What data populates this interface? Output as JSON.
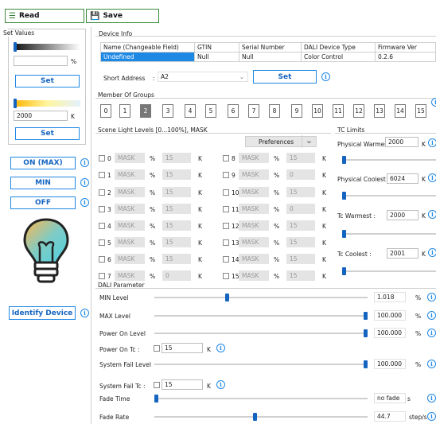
{
  "toolbar": {
    "read_label": "Read",
    "save_label": "Save"
  },
  "set_values": {
    "title": "Set Values",
    "pct_unit": "%",
    "set_label": "Set",
    "cct_value": "2000",
    "cct_unit": "K",
    "set2_label": "Set",
    "on_label": "ON (MAX)",
    "min_label": "MIN",
    "off_label": "OFF",
    "identify_label": "Identify Device"
  },
  "device_info": {
    "title": "Device Info",
    "headers": [
      "Name (Changeable Field)",
      "GTIN",
      "Serial Number",
      "DALI Device Type",
      "Firmware Ver"
    ],
    "row": [
      "Undefined",
      "Null",
      "Null",
      "Color Control",
      "0.2.6"
    ],
    "short_address_label": "Short Address",
    "short_address_colon": ":",
    "short_address_value": "A2",
    "set_label": "Set"
  },
  "groups": {
    "title": "Member Of Groups",
    "items": [
      "0",
      "1",
      "2",
      "3",
      "4",
      "5",
      "6",
      "7",
      "8",
      "9",
      "10",
      "11",
      "12",
      "13",
      "14",
      "15"
    ],
    "selected": 2
  },
  "scenes": {
    "title": "Scene Light Levels [0...100%], MASK",
    "preferences_label": "Preferences",
    "left": [
      {
        "n": "0",
        "mask": "MASK",
        "pct": "%",
        "val": "15",
        "k": "K"
      },
      {
        "n": "1",
        "mask": "MASK",
        "pct": "%",
        "val": "15",
        "k": "K"
      },
      {
        "n": "2",
        "mask": "MASK",
        "pct": "%",
        "val": "15",
        "k": "K"
      },
      {
        "n": "3",
        "mask": "MASK",
        "pct": "%",
        "val": "15",
        "k": "K"
      },
      {
        "n": "4",
        "mask": "MASK",
        "pct": "%",
        "val": "15",
        "k": "K"
      },
      {
        "n": "5",
        "mask": "MASK",
        "pct": "%",
        "val": "15",
        "k": "K"
      },
      {
        "n": "6",
        "mask": "MASK",
        "pct": "%",
        "val": "15",
        "k": "K"
      },
      {
        "n": "7",
        "mask": "MASK",
        "pct": "%",
        "val": "0",
        "k": "K"
      }
    ],
    "right": [
      {
        "n": "8",
        "mask": "MASK",
        "pct": "%",
        "val": "15",
        "k": "K"
      },
      {
        "n": "9",
        "mask": "MASK",
        "pct": "%",
        "val": "0",
        "k": "K"
      },
      {
        "n": "10",
        "mask": "MASK",
        "pct": "%",
        "val": "15",
        "k": "K"
      },
      {
        "n": "11",
        "mask": "MASK",
        "pct": "%",
        "val": "0",
        "k": "K"
      },
      {
        "n": "12",
        "mask": "MASK",
        "pct": "%",
        "val": "15",
        "k": "K"
      },
      {
        "n": "13",
        "mask": "MASK",
        "pct": "%",
        "val": "15",
        "k": "K"
      },
      {
        "n": "14",
        "mask": "MASK",
        "pct": "%",
        "val": "15",
        "k": "K"
      },
      {
        "n": "15",
        "mask": "MASK",
        "pct": "%",
        "val": "15",
        "k": "K"
      }
    ]
  },
  "tc_limits": {
    "title": "TC Limits",
    "physical_warmest_label": "Physical Warmest :",
    "physical_warmest_value": "2000",
    "physical_coolest_label": "Physical Coolest :",
    "physical_coolest_value": "6024",
    "tc_warmest_label": "Tc Warmest :",
    "tc_warmest_value": "2000",
    "tc_coolest_label": "Tc Coolest :",
    "tc_coolest_value": "2001",
    "unit": "K"
  },
  "dali": {
    "title": "DALI Parameter",
    "min_level_label": "MIN Level",
    "min_level_value": "1.018",
    "min_level_unit": "%",
    "min_level_frac": 0.34,
    "max_level_label": "MAX Level",
    "max_level_value": "100.000",
    "max_level_unit": "%",
    "max_level_frac": 1.0,
    "power_on_label": "Power On Level",
    "power_on_value": "100.000",
    "power_on_unit": "%",
    "power_on_frac": 1.0,
    "power_on_tc_label": "Power On Tc :",
    "power_on_tc_value": "15",
    "power_on_tc_unit": "K",
    "system_fail_label": "System Fail Level",
    "system_fail_value": "100.000",
    "system_fail_unit": "%",
    "system_fail_frac": 1.0,
    "system_fail_tc_label": "System Fail Tc :",
    "system_fail_tc_value": "15",
    "system_fail_tc_unit": "K",
    "fade_time_label": "Fade Time",
    "fade_time_value": "no fade",
    "fade_time_unit": "s",
    "fade_time_frac": 0.0,
    "fade_rate_label": "Fade Rate",
    "fade_rate_value": "44.7",
    "fade_rate_unit": "step/s",
    "fade_rate_frac": 0.47
  },
  "colors": {
    "accent": "#1e88e5",
    "green": "#3a8a3a",
    "thumb": "#1565c0"
  }
}
